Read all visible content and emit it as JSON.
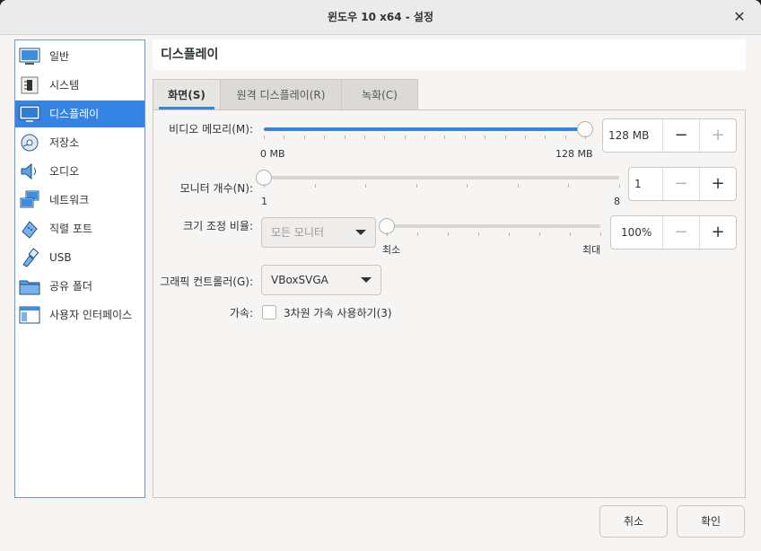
{
  "window": {
    "title": "윈도우 10 x64 - 설정"
  },
  "sidebar": {
    "items": [
      {
        "label": "일반",
        "icon": "general-icon"
      },
      {
        "label": "시스템",
        "icon": "system-icon"
      },
      {
        "label": "디스플레이",
        "icon": "display-icon",
        "active": true
      },
      {
        "label": "저장소",
        "icon": "storage-icon"
      },
      {
        "label": "오디오",
        "icon": "audio-icon"
      },
      {
        "label": "네트워크",
        "icon": "network-icon"
      },
      {
        "label": "직렬 포트",
        "icon": "serial-port-icon"
      },
      {
        "label": "USB",
        "icon": "usb-icon"
      },
      {
        "label": "공유 폴더",
        "icon": "shared-folder-icon"
      },
      {
        "label": "사용자 인터페이스",
        "icon": "user-interface-icon"
      }
    ]
  },
  "header": {
    "title": "디스플레이"
  },
  "tabs": [
    {
      "label": "화면(S)",
      "active": true
    },
    {
      "label": "원격 디스플레이(R)"
    },
    {
      "label": "녹화(C)"
    }
  ],
  "screen": {
    "video_memory": {
      "label": "비디오 메모리(M):",
      "min_label": "0 MB",
      "max_label": "128 MB",
      "value": "128 MB",
      "level": 1.0
    },
    "monitor_count": {
      "label": "모니터 개수(N):",
      "min_label": "1",
      "max_label": "8",
      "value": "1",
      "level": 0.0
    },
    "scale_factor": {
      "label": "크기 조정 비율:",
      "combo_value": "모든 모니터",
      "min_label": "최소",
      "max_label": "최대",
      "value": "100%",
      "level": 0.0
    },
    "graphics_controller": {
      "label": "그래픽 컨트롤러(G):",
      "value": "VBoxSVGA"
    },
    "acceleration": {
      "label": "가속:",
      "checkbox_label": "3차원 가속 사용하기(3)",
      "checked": false
    }
  },
  "spin": {
    "minus": "−",
    "plus": "+"
  },
  "footer": {
    "cancel": "취소",
    "ok": "확인"
  }
}
